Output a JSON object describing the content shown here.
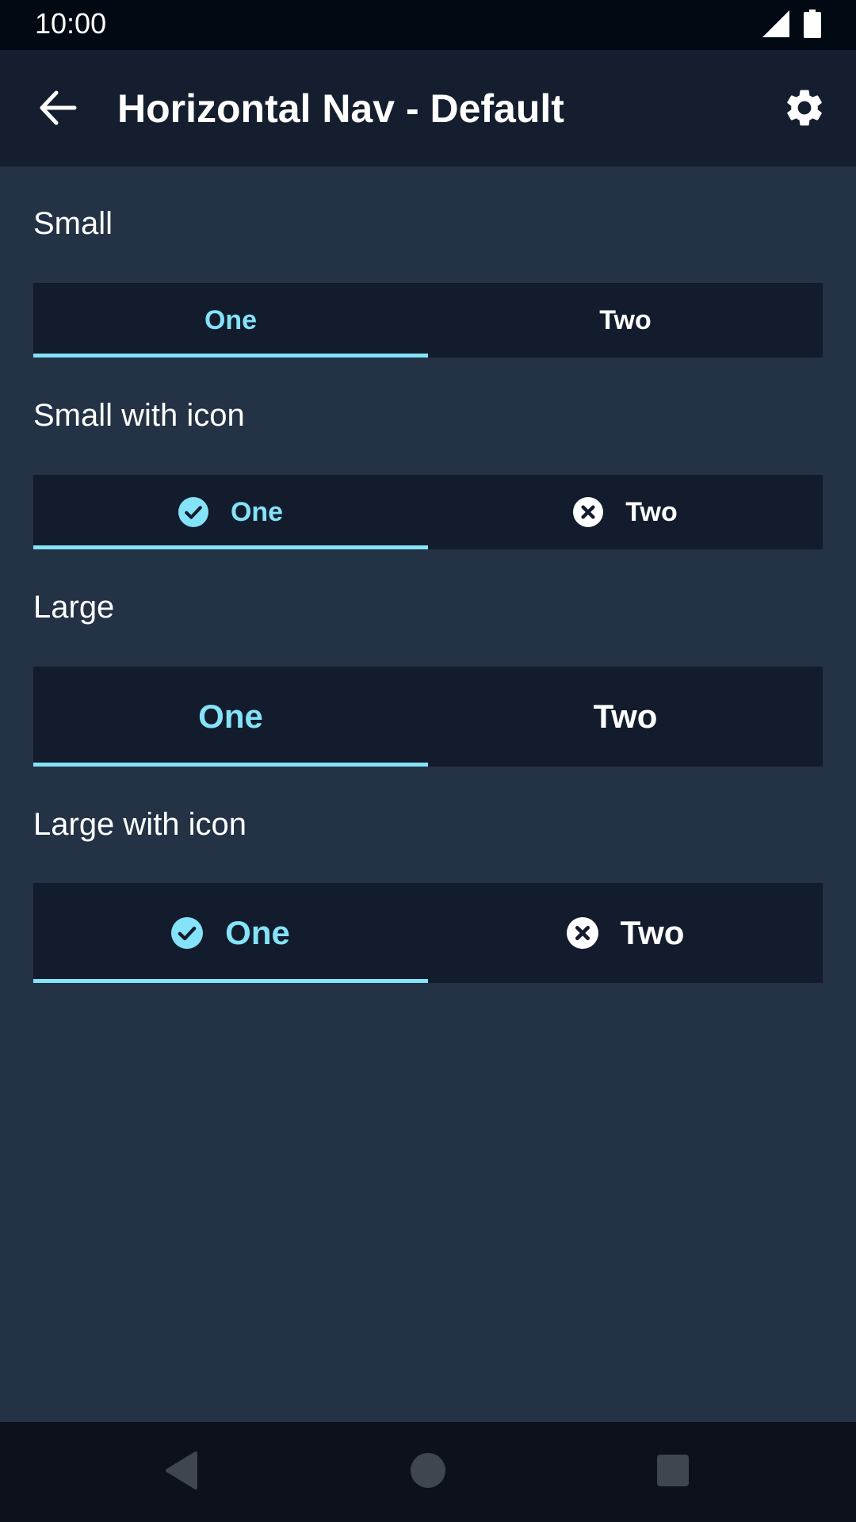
{
  "status_bar": {
    "time": "10:00"
  },
  "app_bar": {
    "title": "Horizontal Nav - Default"
  },
  "sections": [
    {
      "label": "Small",
      "tabs": [
        {
          "label": "One",
          "active": true
        },
        {
          "label": "Two",
          "active": false
        }
      ]
    },
    {
      "label": "Small with icon",
      "tabs": [
        {
          "label": "One",
          "icon": "check-circle-icon",
          "active": true
        },
        {
          "label": "Two",
          "icon": "close-circle-icon",
          "active": false
        }
      ]
    },
    {
      "label": "Large",
      "tabs": [
        {
          "label": "One",
          "active": true
        },
        {
          "label": "Two",
          "active": false
        }
      ]
    },
    {
      "label": "Large with icon",
      "tabs": [
        {
          "label": "One",
          "icon": "check-circle-icon",
          "active": true
        },
        {
          "label": "Two",
          "icon": "close-circle-icon",
          "active": false
        }
      ]
    }
  ],
  "colors": {
    "background": "#233245",
    "app_bar": "#141e2e",
    "tab_bar": "#131c2d",
    "accent": "#84e3f8",
    "status_bar": "#020912",
    "nav_bar": "#0c111b"
  }
}
